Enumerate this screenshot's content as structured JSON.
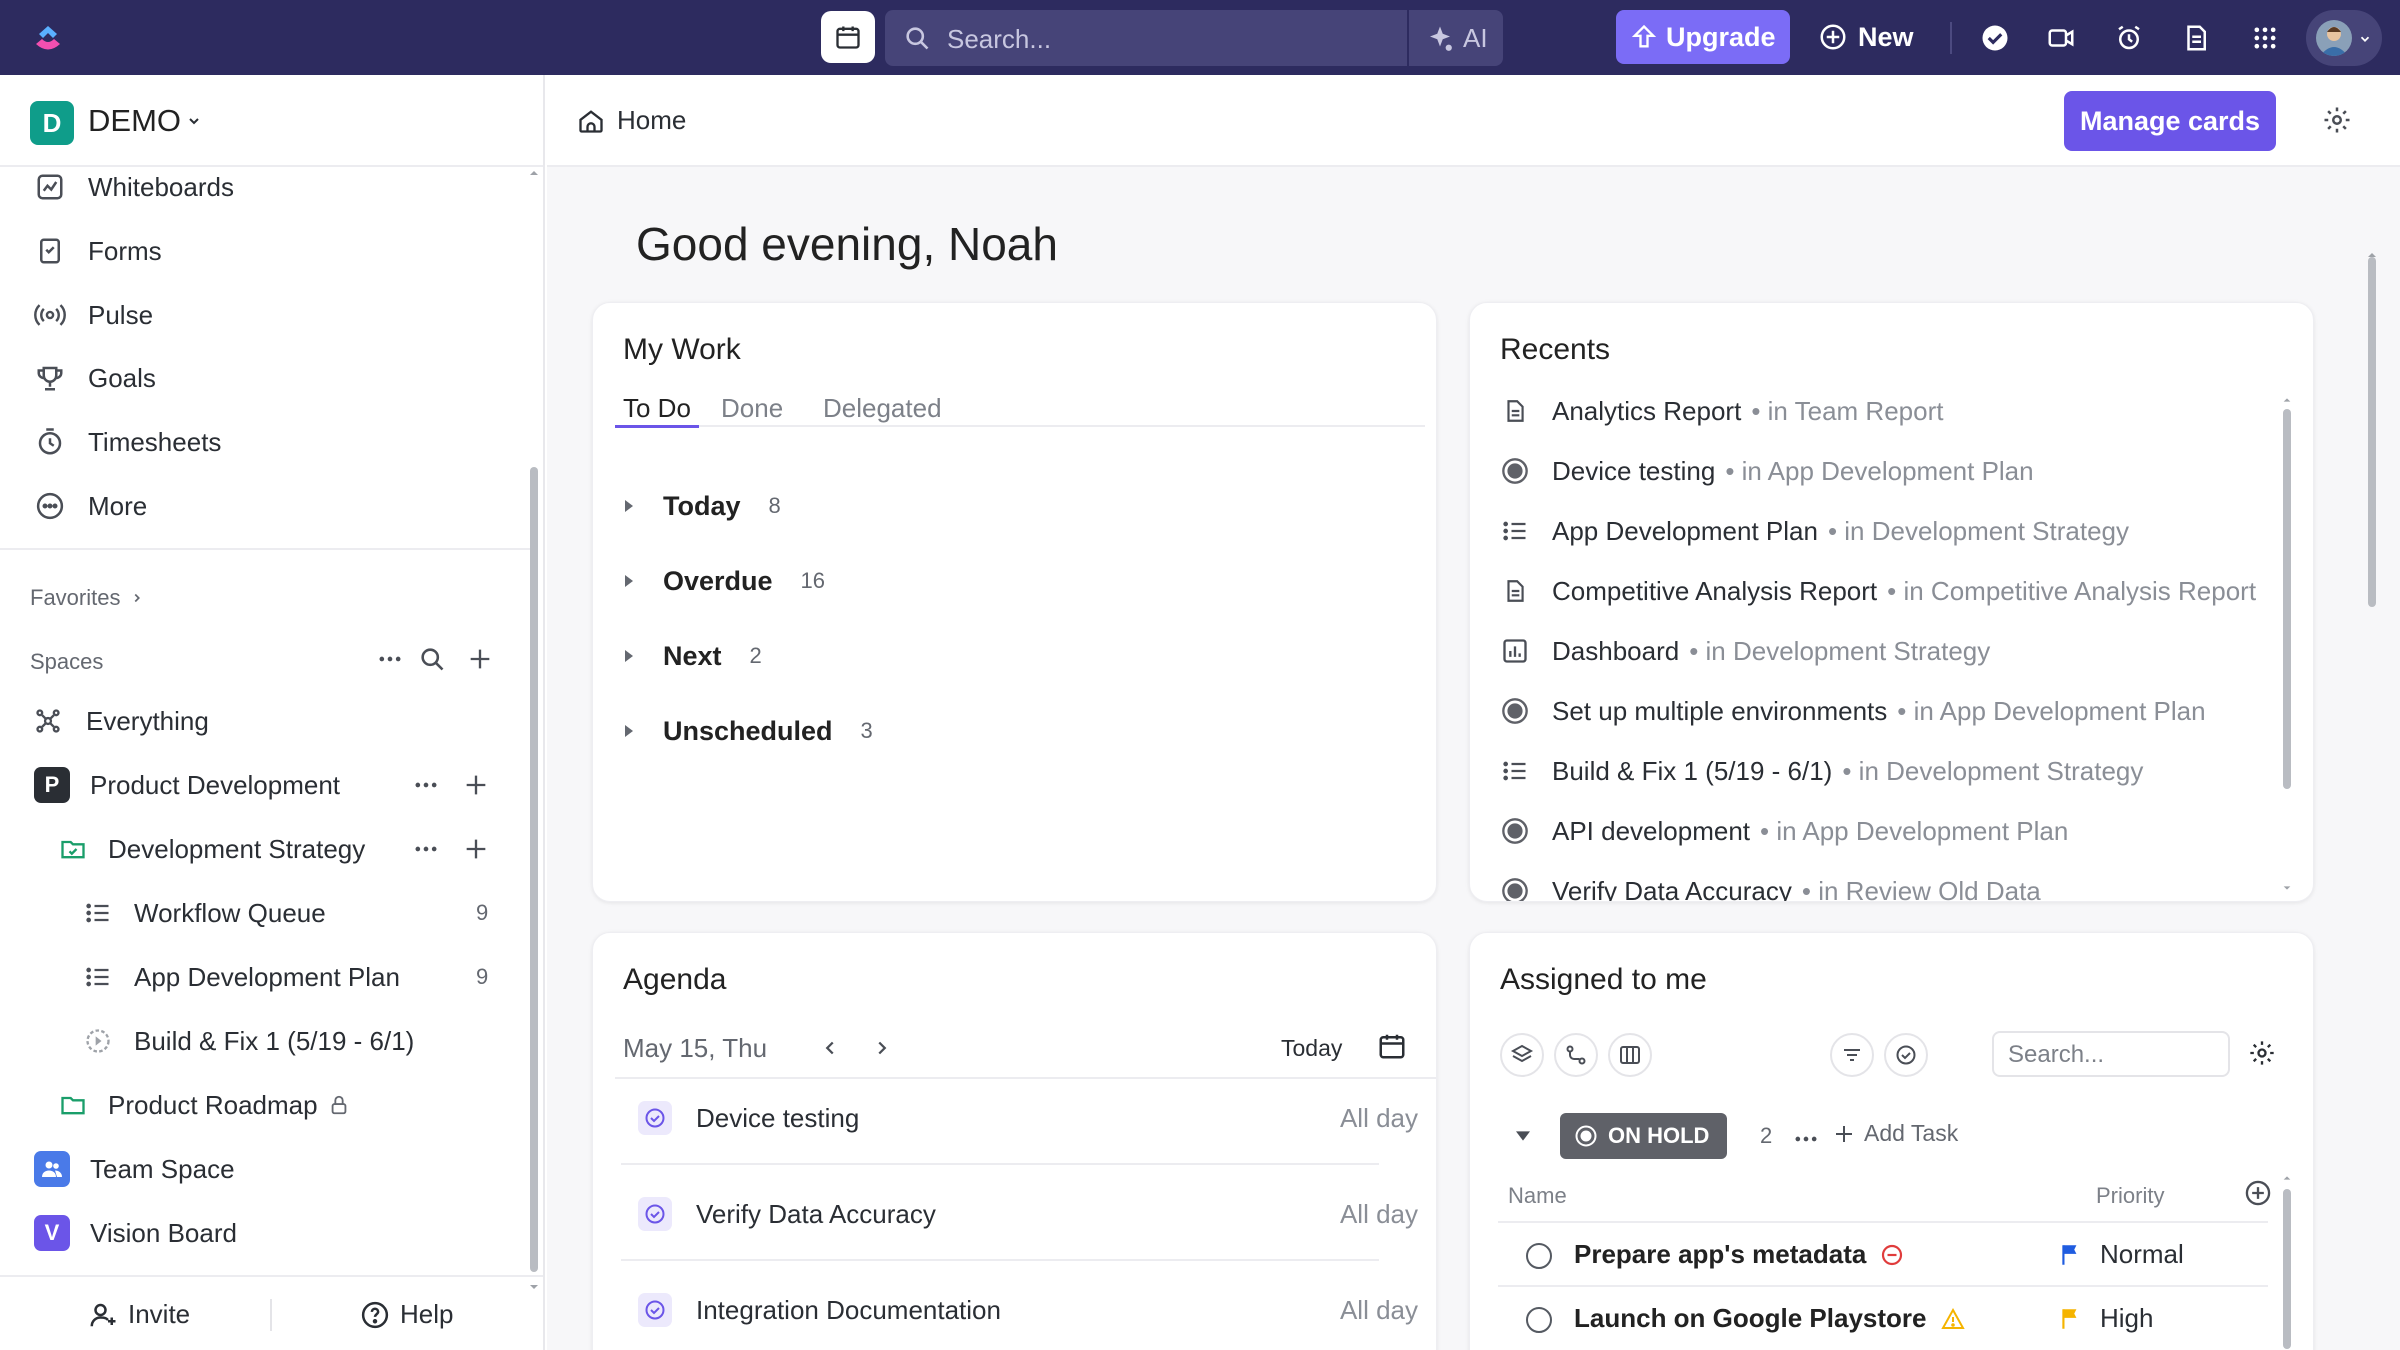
{
  "topbar": {
    "search_placeholder": "Search...",
    "ai_label": "AI",
    "upgrade_label": "Upgrade",
    "new_label": "New"
  },
  "workspace": {
    "initial": "D",
    "name": "DEMO"
  },
  "sidebar": {
    "nav": [
      {
        "label": "Whiteboards",
        "icon": "whiteboard-icon"
      },
      {
        "label": "Forms",
        "icon": "form-icon"
      },
      {
        "label": "Pulse",
        "icon": "pulse-icon"
      },
      {
        "label": "Goals",
        "icon": "trophy-icon"
      },
      {
        "label": "Timesheets",
        "icon": "timesheet-icon"
      },
      {
        "label": "More",
        "icon": "more-icon"
      }
    ],
    "favorites_label": "Favorites",
    "spaces_label": "Spaces",
    "everything_label": "Everything",
    "tree": {
      "product_dev": {
        "initial": "P",
        "label": "Product Development"
      },
      "dev_strategy": {
        "label": "Development Strategy"
      },
      "workflow_queue": {
        "label": "Workflow Queue",
        "count": "9"
      },
      "app_dev_plan": {
        "label": "App Development Plan",
        "count": "9"
      },
      "build_fix": {
        "label": "Build & Fix 1 (5/19 - 6/1)"
      },
      "product_roadmap": {
        "label": "Product Roadmap"
      },
      "team_space": {
        "label": "Team Space"
      },
      "vision_board": {
        "initial": "V",
        "label": "Vision Board"
      }
    },
    "footer": {
      "invite_label": "Invite",
      "help_label": "Help"
    }
  },
  "main": {
    "breadcrumb": "Home",
    "manage_cards_label": "Manage cards",
    "greeting": "Good evening, Noah"
  },
  "my_work": {
    "title": "My Work",
    "tabs": [
      "To Do",
      "Done",
      "Delegated"
    ],
    "groups": [
      {
        "label": "Today",
        "count": "8"
      },
      {
        "label": "Overdue",
        "count": "16"
      },
      {
        "label": "Next",
        "count": "2"
      },
      {
        "label": "Unscheduled",
        "count": "3"
      }
    ]
  },
  "recents": {
    "title": "Recents",
    "items": [
      {
        "name": "Analytics Report",
        "loc": "• in Team Report",
        "icon": "doc-icon"
      },
      {
        "name": "Device testing",
        "loc": "• in App Development Plan",
        "icon": "task-status-icon"
      },
      {
        "name": "App Development Plan",
        "loc": "• in Development Strategy",
        "icon": "list-icon"
      },
      {
        "name": "Competitive Analysis Report",
        "loc": "• in Competitive Analysis Report",
        "icon": "doc-icon"
      },
      {
        "name": "Dashboard",
        "loc": "• in Development Strategy",
        "icon": "dashboard-icon"
      },
      {
        "name": "Set up multiple environments",
        "loc": "• in App Development Plan",
        "icon": "task-status-icon"
      },
      {
        "name": "Build & Fix 1 (5/19 - 6/1)",
        "loc": "• in Development Strategy",
        "icon": "list-icon"
      },
      {
        "name": "API development",
        "loc": "• in App Development Plan",
        "icon": "task-status-icon"
      },
      {
        "name": "Verify Data Accuracy",
        "loc": "• in Review Old Data",
        "icon": "task-status-icon"
      }
    ]
  },
  "agenda": {
    "title": "Agenda",
    "date": "May 15, Thu",
    "today_label": "Today",
    "items": [
      {
        "name": "Device testing",
        "when": "All day"
      },
      {
        "name": "Verify Data Accuracy",
        "when": "All day"
      },
      {
        "name": "Integration Documentation",
        "when": "All day"
      }
    ]
  },
  "assigned": {
    "title": "Assigned to me",
    "search_placeholder": "Search...",
    "status": "ON HOLD",
    "status_count": "2",
    "add_task_label": "Add Task",
    "col_name": "Name",
    "col_priority": "Priority",
    "tasks": [
      {
        "name": "Prepare app's metadata",
        "priority": "Normal",
        "priority_color": "#1f5ce0",
        "tag_icon": "blocked-icon"
      },
      {
        "name": "Launch on Google Playstore",
        "priority": "High",
        "priority_color": "#f5b400",
        "tag_icon": "warning-icon"
      }
    ]
  },
  "colors": {
    "topbar": "#2d2b5f",
    "accent": "#6b55e8",
    "upgrade": "#7b6cf6",
    "workspace_badge": "#0f9d8a",
    "space_product": "#2a2e34",
    "space_team": "#4a7ae8",
    "space_vision": "#6b55e8"
  }
}
